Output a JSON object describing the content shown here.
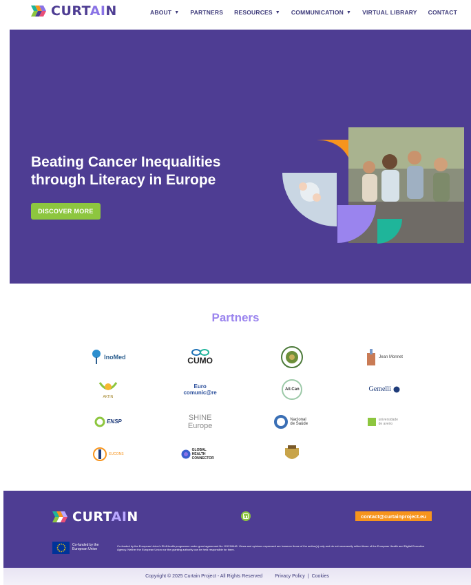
{
  "header": {
    "logo_text_1": "CURT",
    "logo_text_ai": "AI",
    "logo_text_2": "N",
    "nav": [
      {
        "label": "ABOUT",
        "dropdown": true
      },
      {
        "label": "PARTNERS",
        "dropdown": false
      },
      {
        "label": "RESOURCES",
        "dropdown": true
      },
      {
        "label": "COMMUNICATION",
        "dropdown": true
      },
      {
        "label": "VIRTUAL LIBRARY",
        "dropdown": false
      },
      {
        "label": "CONTACT",
        "dropdown": false
      }
    ]
  },
  "hero": {
    "title": "Beating Cancer Inequalities through Literacy in Europe",
    "cta": "DISCOVER MORE"
  },
  "partners": {
    "title": "Partners",
    "logos": [
      {
        "name": "InoMed"
      },
      {
        "name": "CUMO"
      },
      {
        "name": "university-seal"
      },
      {
        "name": "Jean Monnet"
      },
      {
        "name": "AKTIN"
      },
      {
        "name": "Euro comunic@re"
      },
      {
        "name": "All.Can"
      },
      {
        "name": "Gemelli"
      },
      {
        "name": "ENSP"
      },
      {
        "name": "SHINE Europe"
      },
      {
        "name": "Nacional de Saúde"
      },
      {
        "name": "universidade de aveiro"
      },
      {
        "name": "EUCONS"
      },
      {
        "name": "GLOBAL HEALTH CONNECTOR"
      },
      {
        "name": "coat-of-arms"
      }
    ]
  },
  "footer": {
    "email": "contact@curtainproject.eu",
    "eu_label": "Co-funded by the European Union",
    "disclaimer": "Co-funded by the European Union's EU4Health programme under grant agreement No 101218448. Views and opinions expressed are however those of the author(s) only and do not necessarily reflect those of the European Health and Digital Executive Agency. Neither the European Union nor the granting authority can be held responsible for them.",
    "copyright": "Copyright © 2025 Curtain Project - All Rights Reserved",
    "privacy": "Privacy Policy",
    "separator": "|",
    "cookies": "Cookies"
  },
  "colors": {
    "brand_purple": "#4e3d93",
    "accent_lilac": "#9a84ee",
    "accent_green": "#8dc63f",
    "accent_orange": "#f7941d",
    "accent_teal": "#1fb59a"
  }
}
